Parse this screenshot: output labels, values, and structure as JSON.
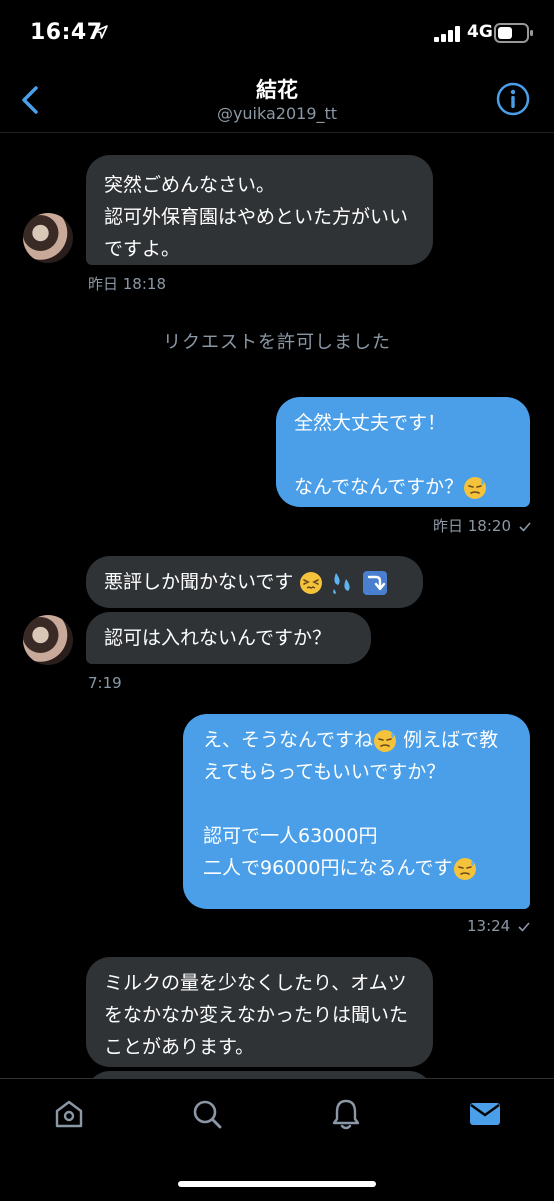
{
  "status_bar": {
    "time": "16:47",
    "network": "4G"
  },
  "header": {
    "name": "結花",
    "handle": "@yuika2019_tt"
  },
  "messages": [
    {
      "text": "突然ごめんなさい。\n認可外保育園はやめといた方がいいですよ。",
      "time": "昨日 18:18"
    },
    {
      "system": "リクエストを許可しました"
    },
    {
      "text": "全然大丈夫です！\n\nなんでなんですか？",
      "time": "昨日 18:20"
    },
    {
      "text": "悪評しか聞かないです"
    },
    {
      "text": "認可は入れないんですか？",
      "time": "7:19"
    },
    {
      "text_line1": "え、そうなんですね",
      "text_rest": "例えばで教えてもらってもいいですか？\n\n認可で一人63000円\n二人で96000円になるんです",
      "time": "13:24"
    },
    {
      "text": "ミルクの量を少なくしたり、オムツをなかなか変えなかったりは聞いたことがあります。"
    }
  ],
  "tabs": [
    "home",
    "search",
    "notifications",
    "messages"
  ],
  "colors": {
    "accent": "#4a9fe8",
    "incoming_bubble": "#2f3336",
    "muted": "#8b98a5"
  }
}
